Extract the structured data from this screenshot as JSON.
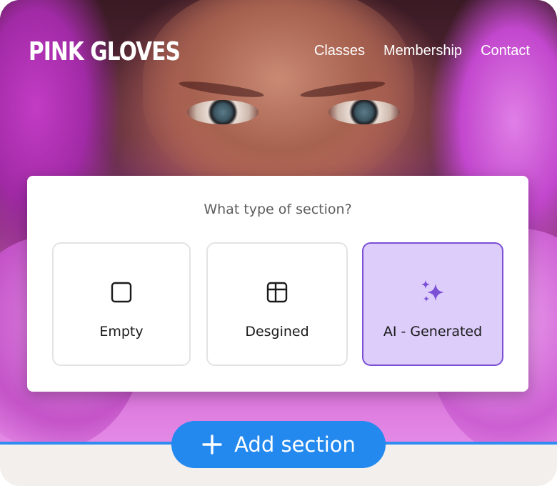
{
  "brand": {
    "logo_text": "PINK GLOVES"
  },
  "nav": {
    "items": [
      "Classes",
      "Membership",
      "Contact"
    ]
  },
  "dialog": {
    "title": "What type of section?",
    "options": [
      {
        "label": "Empty",
        "icon": "square-icon",
        "selected": false
      },
      {
        "label": "Desgined",
        "icon": "layout-icon",
        "selected": false
      },
      {
        "label": "AI - Generated",
        "icon": "sparkles-icon",
        "selected": true
      }
    ]
  },
  "add_section": {
    "label": "Add section",
    "icon": "plus-icon"
  },
  "colors": {
    "accent_blue": "#2389ef",
    "selected_bg": "#dccdfa",
    "selected_border": "#7b4fd6",
    "sparkle": "#7b4fd6"
  }
}
